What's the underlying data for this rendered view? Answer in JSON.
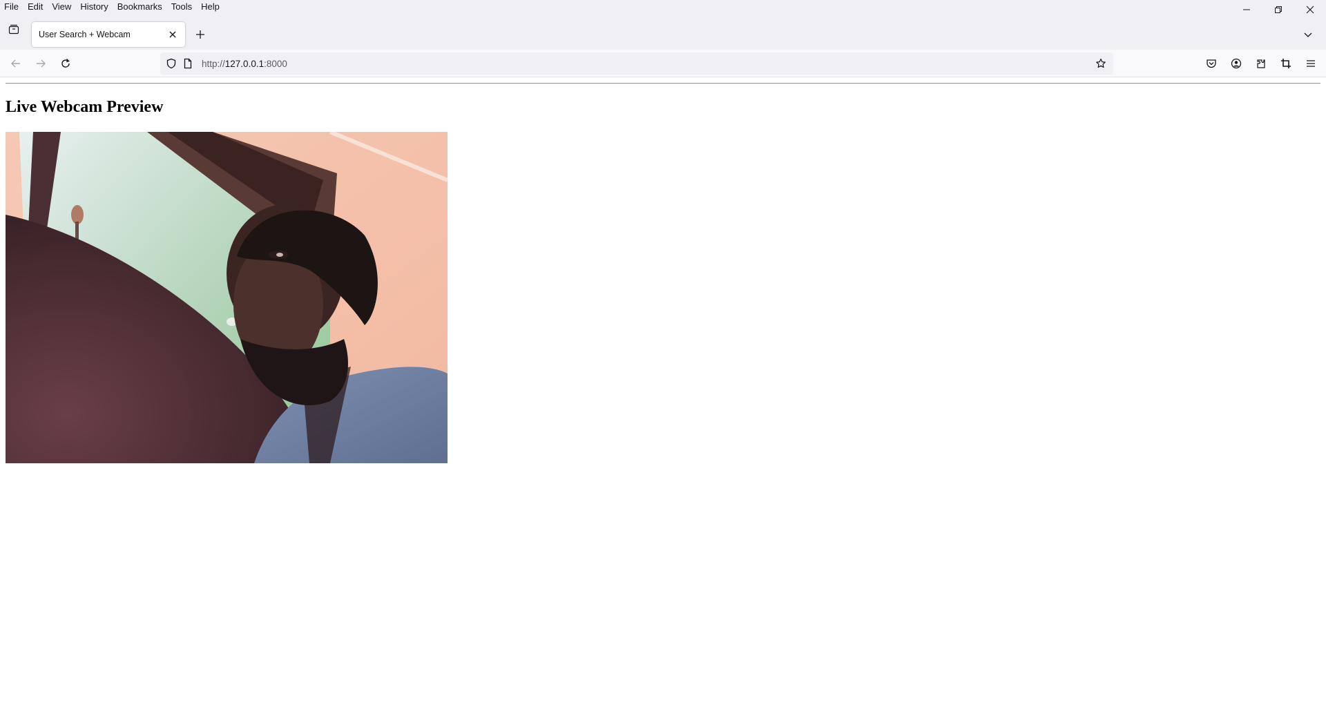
{
  "menubar": {
    "items": [
      "File",
      "Edit",
      "View",
      "History",
      "Bookmarks",
      "Tools",
      "Help"
    ]
  },
  "tab": {
    "title": "User Search + Webcam"
  },
  "urlbar": {
    "scheme": "http://",
    "host": "127.0.0.1",
    "port": ":8000"
  },
  "page": {
    "heading": "Live Webcam Preview"
  },
  "icons": {
    "tab_list": "tab-list-icon",
    "close_tab": "close-icon",
    "new_tab": "plus-icon",
    "tabs_overflow": "chevron-down-icon",
    "back": "arrow-left-icon",
    "forward": "arrow-right-icon",
    "reload": "reload-icon",
    "tracking_protection": "shield-icon",
    "page_info": "page-icon",
    "bookmark": "star-icon",
    "pocket": "pocket-icon",
    "account": "account-icon",
    "extensions": "puzzle-icon",
    "screenshot": "crop-icon",
    "menu": "hamburger-icon"
  },
  "colors": {
    "chrome_bg": "#f0f0f4",
    "navbar_bg": "#f9f9fb",
    "text": "#15141a"
  }
}
